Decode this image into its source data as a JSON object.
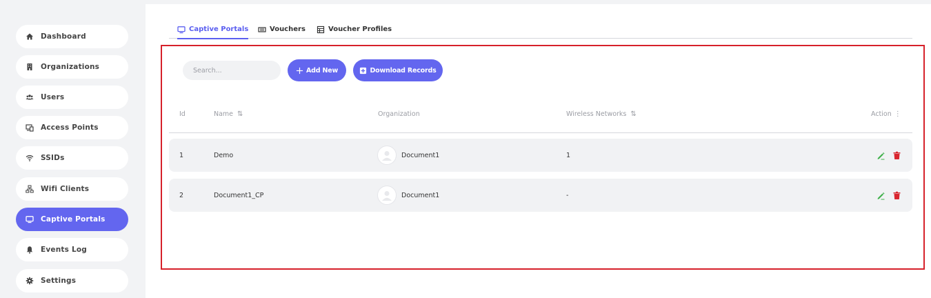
{
  "sidebar": {
    "items": [
      {
        "label": "Dashboard",
        "icon": "home-icon"
      },
      {
        "label": "Organizations",
        "icon": "building-icon"
      },
      {
        "label": "Users",
        "icon": "users-icon"
      },
      {
        "label": "Access Points",
        "icon": "access-point-icon"
      },
      {
        "label": "SSIDs",
        "icon": "wifi-icon"
      },
      {
        "label": "Wifi Clients",
        "icon": "network-icon"
      },
      {
        "label": "Captive Portals",
        "icon": "monitor-icon",
        "active": true
      },
      {
        "label": "Events Log",
        "icon": "bell-icon"
      },
      {
        "label": "Settings",
        "icon": "gear-icon"
      }
    ]
  },
  "tabs": [
    {
      "label": "Captive Portals",
      "icon": "monitor-icon",
      "active": true
    },
    {
      "label": "Vouchers",
      "icon": "ticket-icon"
    },
    {
      "label": "Voucher Profiles",
      "icon": "table-icon"
    }
  ],
  "toolbar": {
    "search_placeholder": "Search...",
    "add_new_label": "Add New",
    "download_label": "Download Records"
  },
  "table": {
    "headers": {
      "id": "Id",
      "name": "Name",
      "organization": "Organization",
      "wireless_networks": "Wireless Networks",
      "action": "Action"
    },
    "rows": [
      {
        "id": "1",
        "name": "Demo",
        "organization": "Document1",
        "wireless_networks": "1"
      },
      {
        "id": "2",
        "name": "Document1_CP",
        "organization": "Document1",
        "wireless_networks": "-"
      }
    ]
  },
  "colors": {
    "accent": "#6366ef",
    "sidebar_bg": "#f2f3f5",
    "highlight_border": "#d6202a",
    "edit_icon": "#3fb04a",
    "delete_icon": "#d9262f"
  }
}
